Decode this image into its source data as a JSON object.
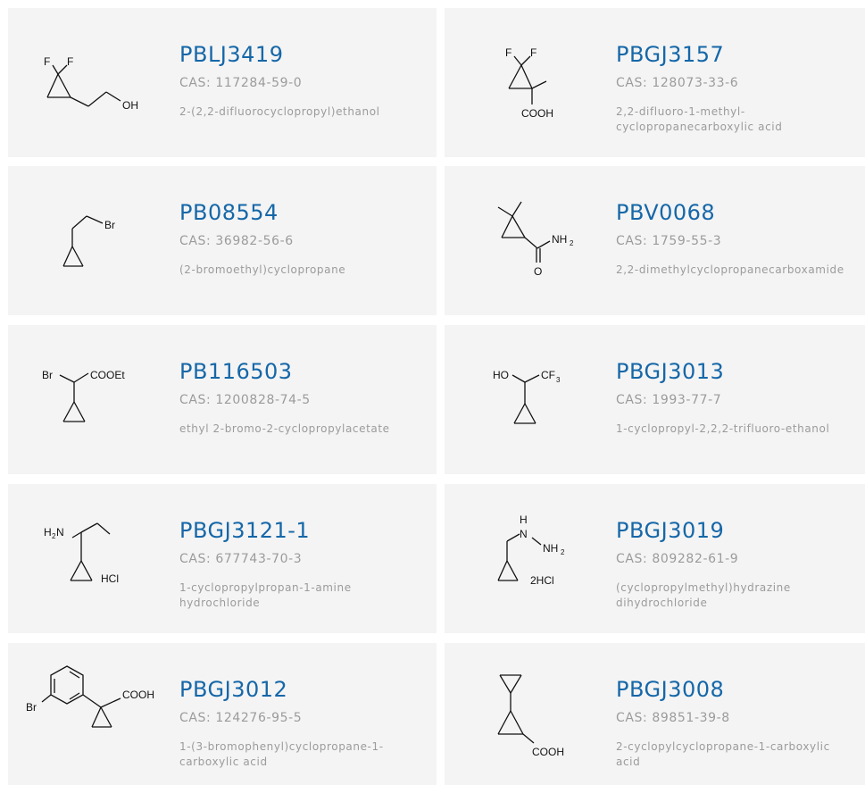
{
  "colors": {
    "card_bg": "#f4f4f4",
    "code": "#1567a8",
    "meta": "#9b9b9b"
  },
  "products": [
    {
      "code": "PBLJ3419",
      "cas": "CAS: 117284-59-0",
      "name": "2-(2,2-difluorocyclopropyl)ethanol",
      "structure_labels": {
        "f1": "F",
        "f2": "F",
        "oh": "OH"
      }
    },
    {
      "code": "PBGJ3157",
      "cas": "CAS: 128073-33-6",
      "name": "2,2-difluoro-1-methyl-\ncyclopropanecarboxylic acid",
      "structure_labels": {
        "f1": "F",
        "f2": "F",
        "cooh": "COOH"
      }
    },
    {
      "code": "PB08554",
      "cas": "CAS: 36982-56-6",
      "name": "(2-bromoethyl)cyclopropane",
      "structure_labels": {
        "br": "Br"
      }
    },
    {
      "code": "PBV0068",
      "cas": "CAS: 1759-55-3",
      "name": "2,2-dimethylcyclopropanecarboxamide",
      "structure_labels": {
        "nh": "NH",
        "nh_sub": "2",
        "o": "O"
      }
    },
    {
      "code": "PB116503",
      "cas": "CAS: 1200828-74-5",
      "name": "ethyl 2-bromo-2-cyclopropylacetate",
      "structure_labels": {
        "br": "Br",
        "cooet": "COOEt"
      }
    },
    {
      "code": "PBGJ3013",
      "cas": "CAS: 1993-77-7",
      "name": "1-cyclopropyl-2,2,2-trifluoro-ethanol",
      "structure_labels": {
        "ho": "HO",
        "cf": "CF",
        "cf_sub": "3"
      }
    },
    {
      "code": "PBGJ3121-1",
      "cas": "CAS: 677743-70-3",
      "name": "1-cyclopropylpropan-1-amine\nhydrochloride",
      "structure_labels": {
        "h2n_h": "H",
        "h2n_sub": "2",
        "h2n_n": "N",
        "hcl": "HCl"
      }
    },
    {
      "code": "PBGJ3019",
      "cas": "CAS: 809282-61-9",
      "name": "(cyclopropylmethyl)hydrazine\ndihydrochloride",
      "structure_labels": {
        "h": "H",
        "n": "N",
        "nh": "NH",
        "nh_sub": "2",
        "hcl": "2HCl"
      }
    },
    {
      "code": "PBGJ3012",
      "cas": "CAS: 124276-95-5",
      "name": "1-(3-bromophenyl)cyclopropane-1-\ncarboxylic acid",
      "structure_labels": {
        "br": "Br",
        "cooh": "COOH"
      }
    },
    {
      "code": "PBGJ3008",
      "cas": "CAS: 89851-39-8",
      "name": "2-cyclopylcyclopropane-1-carboxylic\nacid",
      "structure_labels": {
        "cooh": "COOH"
      }
    }
  ]
}
